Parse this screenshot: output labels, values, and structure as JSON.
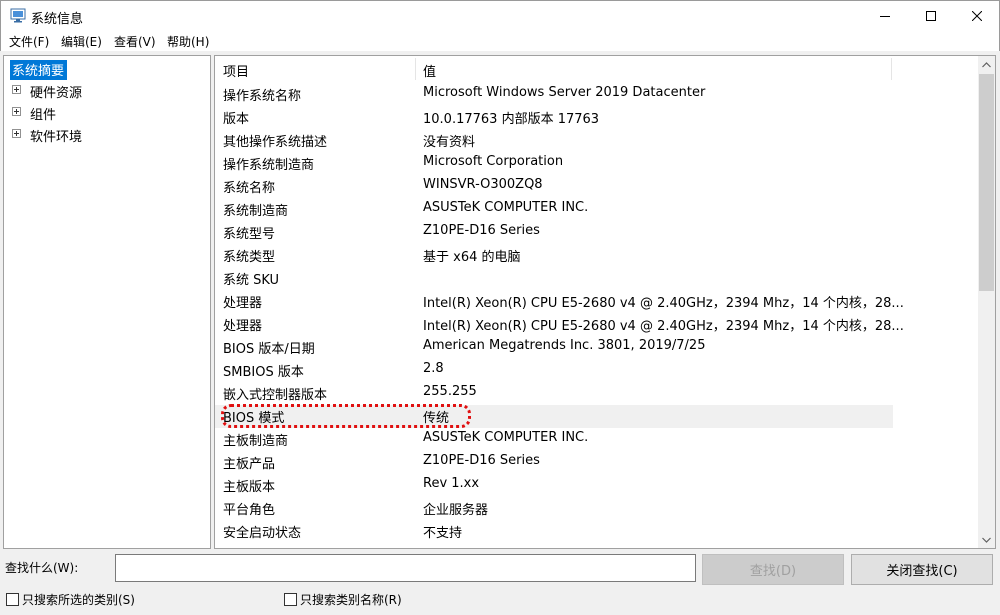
{
  "window": {
    "title": "系统信息"
  },
  "menu": [
    "文件(F)",
    "编辑(E)",
    "查看(V)",
    "帮助(H)"
  ],
  "tree": [
    {
      "label": "系统摘要",
      "selected": true,
      "expandable": false
    },
    {
      "label": "硬件资源",
      "selected": false,
      "expandable": true
    },
    {
      "label": "组件",
      "selected": false,
      "expandable": true
    },
    {
      "label": "软件环境",
      "selected": false,
      "expandable": true
    }
  ],
  "table": {
    "headers": [
      "项目",
      "值"
    ],
    "rows": [
      [
        "操作系统名称",
        "Microsoft Windows Server 2019 Datacenter"
      ],
      [
        "版本",
        "10.0.17763 内部版本 17763"
      ],
      [
        "其他操作系统描述",
        "没有资料"
      ],
      [
        "操作系统制造商",
        "Microsoft Corporation"
      ],
      [
        "系统名称",
        "WINSVR-O300ZQ8"
      ],
      [
        "系统制造商",
        "ASUSTeK COMPUTER INC."
      ],
      [
        "系统型号",
        "Z10PE-D16 Series"
      ],
      [
        "系统类型",
        "基于 x64 的电脑"
      ],
      [
        "系统 SKU",
        ""
      ],
      [
        "处理器",
        "Intel(R) Xeon(R) CPU E5-2680 v4 @ 2.40GHz，2394 Mhz，14 个内核，28..."
      ],
      [
        "处理器",
        "Intel(R) Xeon(R) CPU E5-2680 v4 @ 2.40GHz，2394 Mhz，14 个内核，28..."
      ],
      [
        "BIOS 版本/日期",
        "American Megatrends Inc. 3801, 2019/7/25"
      ],
      [
        "SMBIOS 版本",
        "2.8"
      ],
      [
        "嵌入式控制器版本",
        "255.255"
      ],
      [
        "BIOS 模式",
        "传统"
      ],
      [
        "主板制造商",
        "ASUSTeK COMPUTER INC."
      ],
      [
        "主板产品",
        "Z10PE-D16 Series"
      ],
      [
        "主板版本",
        "Rev 1.xx"
      ],
      [
        "平台角色",
        "企业服务器"
      ],
      [
        "安全启动状态",
        "不支持"
      ]
    ],
    "highlighted_row": 14
  },
  "find": {
    "label": "查找什么(W):",
    "value": "",
    "find_button": "查找(D)",
    "close_button": "关闭查找(C)",
    "opt_selected_category": "只搜索所选的类别(S)",
    "opt_category_names": "只搜索类别名称(R)"
  },
  "colors": {
    "selection": "#0078d7",
    "annotation": "#e01010"
  }
}
